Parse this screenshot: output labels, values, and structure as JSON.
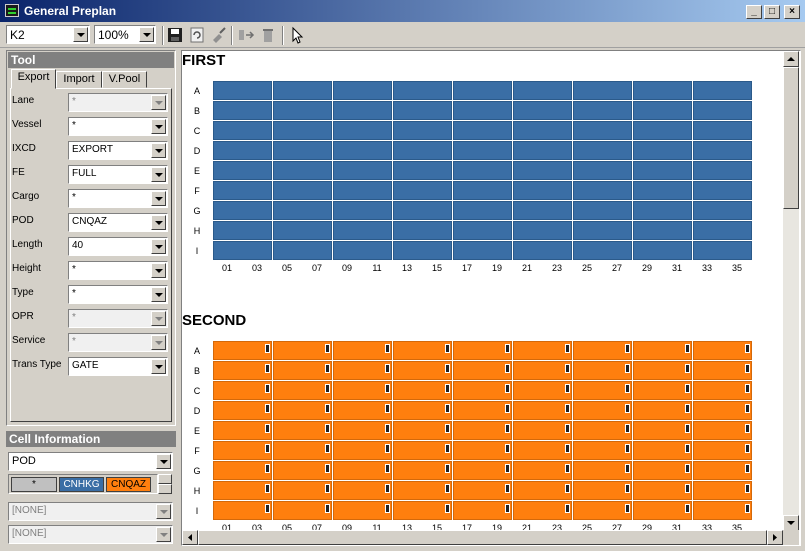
{
  "window": {
    "title": "General Preplan",
    "min_symbol": "_",
    "max_symbol": "□",
    "close_symbol": "×"
  },
  "toolbar": {
    "block_value": "K2",
    "zoom_value": "100%",
    "icons": [
      "save-icon",
      "refresh-icon",
      "broom-icon",
      "swap-icon",
      "trash-icon",
      "pointer-icon"
    ]
  },
  "tool_panel": {
    "header": "Tool",
    "tabs": [
      "Export",
      "Import",
      "V.Pool"
    ],
    "active_tab": "Export",
    "fields": [
      {
        "label": "Lane",
        "value": "*",
        "disabled": true
      },
      {
        "label": "Vessel",
        "value": "*",
        "disabled": false
      },
      {
        "label": "IXCD",
        "value": "EXPORT",
        "disabled": false
      },
      {
        "label": "FE",
        "value": "FULL",
        "disabled": false
      },
      {
        "label": "Cargo",
        "value": "*",
        "disabled": false
      },
      {
        "label": "POD",
        "value": "CNQAZ",
        "disabled": false
      },
      {
        "label": "Length",
        "value": "40",
        "disabled": false
      },
      {
        "label": "Height",
        "value": "*",
        "disabled": false
      },
      {
        "label": "Type",
        "value": "*",
        "disabled": false
      },
      {
        "label": "OPR",
        "value": "*",
        "disabled": true
      },
      {
        "label": "Service",
        "value": "*",
        "disabled": true
      },
      {
        "label": "Trans Type",
        "value": "GATE",
        "disabled": false
      }
    ]
  },
  "cell_info": {
    "header": "Cell Information",
    "attribute": "POD",
    "chips": [
      {
        "label": "*",
        "color": "#c0c0c0",
        "text": "#000000"
      },
      {
        "label": "CNHKG",
        "color": "#3a6ea5",
        "text": "#ffffff"
      },
      {
        "label": "CNQAZ",
        "color": "#ff7f0e",
        "text": "#000000"
      }
    ],
    "none1": "[NONE]",
    "none2": "[NONE]"
  },
  "blocks": [
    {
      "name": "FIRST",
      "color": "#3a6ea5",
      "marked": false
    },
    {
      "name": "SECOND",
      "color": "#ff7f0e",
      "marked": true
    }
  ],
  "rows": [
    "A",
    "B",
    "C",
    "D",
    "E",
    "F",
    "G",
    "H",
    "I"
  ],
  "bays": [
    "01",
    "03",
    "05",
    "07",
    "09",
    "11",
    "13",
    "15",
    "17",
    "19",
    "21",
    "23",
    "25",
    "27",
    "29",
    "31",
    "33",
    "35"
  ],
  "colors": {
    "blue": "#3a6ea5",
    "orange": "#ff7f0e"
  }
}
